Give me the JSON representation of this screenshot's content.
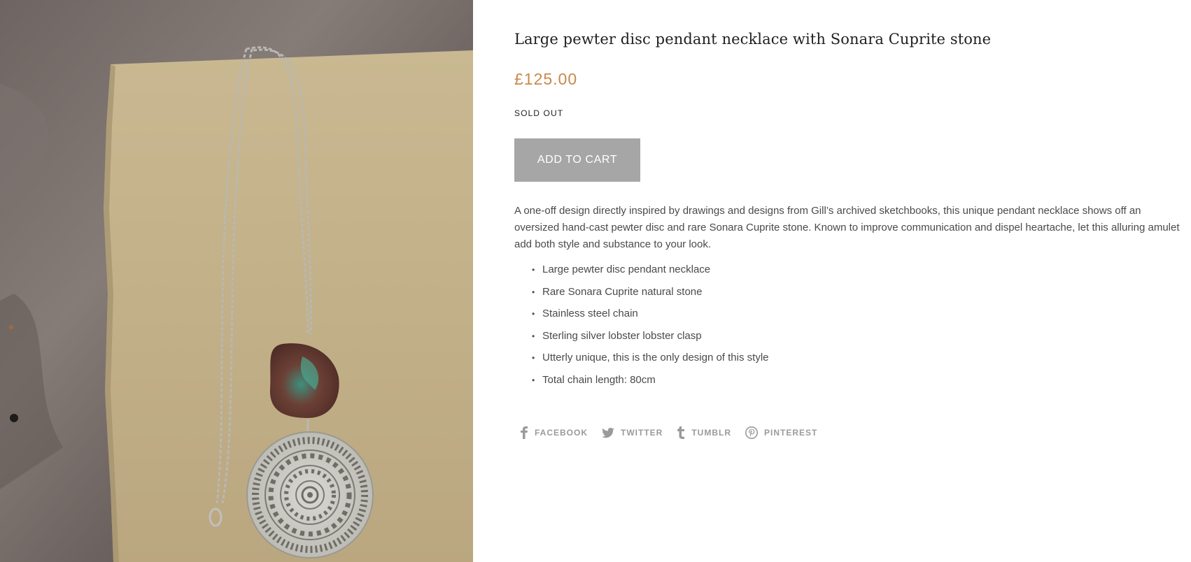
{
  "product": {
    "title": "Large pewter disc pendant necklace with Sonara Cuprite stone",
    "price": "£125.00",
    "stock_status": "SOLD OUT",
    "add_to_cart_label": "ADD TO CART",
    "image_icon": "necklace-photo",
    "description": "A one-off design directly inspired by drawings and designs from Gill’s archived sketchbooks, this unique pendant necklace shows off an oversized hand-cast pewter disc and rare Sonara Cuprite stone. Known to improve communication and dispel heartache, let this alluring amulet add both style and substance to your look.",
    "features": [
      "Large pewter disc pendant necklace",
      "Rare Sonara Cuprite natural stone",
      "Stainless steel chain",
      "Sterling silver lobster lobster clasp",
      "Utterly unique, this is the only design of this style",
      "Total chain length: 80cm"
    ]
  },
  "share": {
    "facebook": "FACEBOOK",
    "twitter": "TWITTER",
    "tumblr": "TUMBLR",
    "pinterest": "PINTEREST"
  },
  "colors": {
    "price": "#c8894a",
    "button": "#a6a6a6",
    "share_text": "#9a9a9a"
  }
}
